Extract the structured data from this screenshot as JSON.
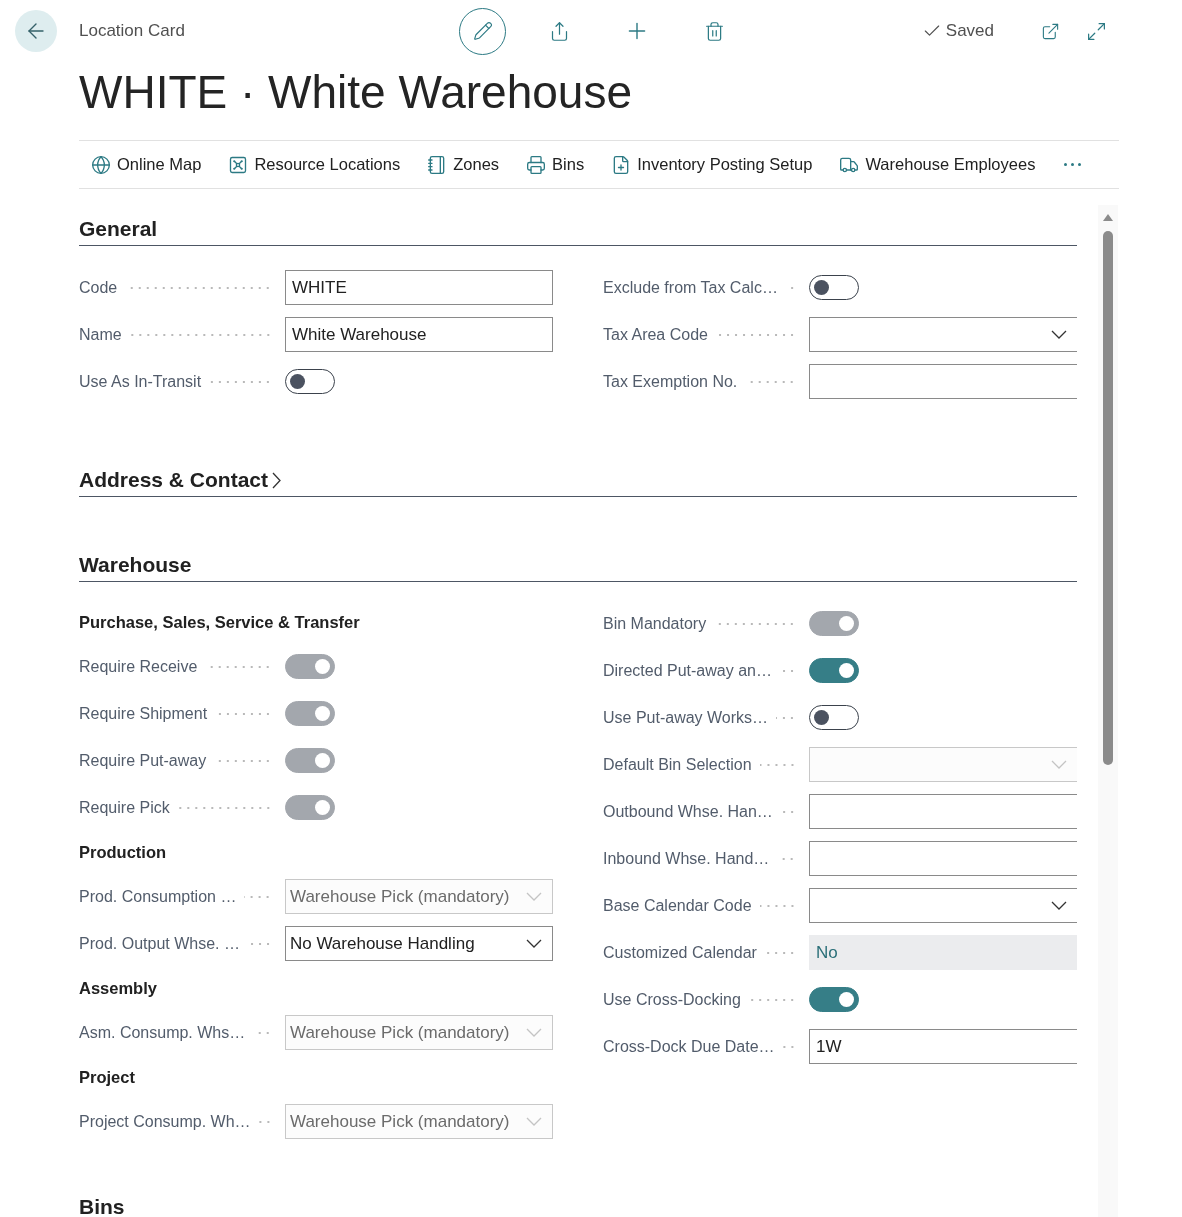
{
  "header": {
    "breadcrumb": "Location Card",
    "status": "Saved",
    "title": "WHITE · White Warehouse"
  },
  "actions": [
    "Online Map",
    "Resource Locations",
    "Zones",
    "Bins",
    "Inventory Posting Setup",
    "Warehouse Employees"
  ],
  "sections": [
    {
      "title": "General",
      "expanded": true,
      "columns": [
        [
          {
            "kind": "text",
            "label": "Code",
            "value": "WHITE"
          },
          {
            "kind": "text",
            "label": "Name",
            "value": "White Warehouse"
          },
          {
            "kind": "toggle",
            "label": "Use As In-Transit",
            "on": false,
            "disabled": false
          }
        ],
        [
          {
            "kind": "toggle",
            "label": "Exclude from Tax Calc…",
            "on": false,
            "disabled": false
          },
          {
            "kind": "dropdown",
            "label": "Tax Area Code",
            "disabled": false
          },
          {
            "kind": "text",
            "label": "Tax Exemption No."
          }
        ]
      ]
    },
    {
      "title": "Address & Contact",
      "expanded": false
    },
    {
      "title": "Warehouse",
      "expanded": true,
      "columns": [
        [
          {
            "kind": "heading",
            "text": "Purchase, Sales, Service & Transfer"
          },
          {
            "kind": "toggle",
            "label": "Require Receive",
            "on": true,
            "disabled": true
          },
          {
            "kind": "toggle",
            "label": "Require Shipment",
            "on": true,
            "disabled": true
          },
          {
            "kind": "toggle",
            "label": "Require Put-away",
            "on": true,
            "disabled": true
          },
          {
            "kind": "toggle",
            "label": "Require Pick",
            "on": true,
            "disabled": true
          },
          {
            "kind": "heading",
            "text": "Production"
          },
          {
            "kind": "dropdown",
            "label": "Prod. Consumption …",
            "value": "Warehouse Pick (mandatory)",
            "disabled": true
          },
          {
            "kind": "dropdown",
            "label": "Prod. Output Whse. …",
            "value": "No Warehouse Handling",
            "disabled": false
          },
          {
            "kind": "heading",
            "text": "Assembly"
          },
          {
            "kind": "dropdown",
            "label": "Asm. Consump. Whs…",
            "value": "Warehouse Pick (mandatory)",
            "disabled": true
          },
          {
            "kind": "heading",
            "text": "Project"
          },
          {
            "kind": "dropdown",
            "label": "Project Consump. Wh…",
            "value": "Warehouse Pick (mandatory)",
            "disabled": true
          }
        ],
        [
          {
            "kind": "toggle",
            "label": "Bin Mandatory",
            "on": true,
            "disabled": true
          },
          {
            "kind": "toggle",
            "label": "Directed Put-away an…",
            "on": true,
            "disabled": false
          },
          {
            "kind": "toggle",
            "label": "Use Put-away Works…",
            "on": false,
            "disabled": false
          },
          {
            "kind": "dropdown",
            "label": "Default Bin Selection",
            "disabled": true
          },
          {
            "kind": "text",
            "label": "Outbound Whse. Han…"
          },
          {
            "kind": "text",
            "label": "Inbound Whse. Hand…"
          },
          {
            "kind": "dropdown",
            "label": "Base Calendar Code",
            "disabled": false
          },
          {
            "kind": "readonly",
            "label": "Customized Calendar",
            "value": "No"
          },
          {
            "kind": "toggle",
            "label": "Use Cross-Docking",
            "on": true,
            "disabled": false
          },
          {
            "kind": "text",
            "label": "Cross-Dock Due Date…",
            "value": "1W"
          }
        ]
      ]
    },
    {
      "title": "Bins",
      "expanded": true
    }
  ]
}
